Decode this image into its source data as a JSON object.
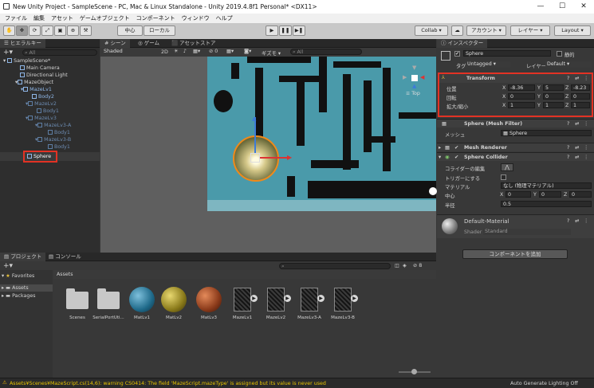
{
  "window": {
    "title": "New Unity Project - SampleScene - PC, Mac & Linux Standalone - Unity 2019.4.8f1 Personal* <DX11>"
  },
  "menu": [
    "ファイル",
    "編集",
    "アセット",
    "ゲームオブジェクト",
    "コンポーネント",
    "ウィンドウ",
    "ヘルプ"
  ],
  "toolbar": {
    "pivot": "中心",
    "space": "ローカル",
    "collab": "Collab ▾",
    "account": "アカウント ▾",
    "layers": "レイヤー ▾",
    "layout": "Layout ▾"
  },
  "hierarchy": {
    "tab": "ヒエラルキー",
    "search": "All",
    "scene": "SampleScene*",
    "items": [
      "Main Camera",
      "Directional Light",
      "MazeObject",
      "MazeLv1",
      "Body2",
      "MazeLv2",
      "Body1",
      "MazeLv3",
      "MazeLv3-A",
      "Body1",
      "MazeLv3-B",
      "Body1",
      "Sphere"
    ]
  },
  "scene": {
    "tabs": [
      "シーン",
      "ゲーム",
      "アセットストア"
    ],
    "shading": "Shaded",
    "mode2d": "2D",
    "gizmos": "ギズモ",
    "search": "All",
    "view": "Top",
    "status_value": "0"
  },
  "inspector": {
    "tab": "インスペクター",
    "name": "Sphere",
    "static": "静的",
    "tag_label": "タグ",
    "tag": "Untagged",
    "layer_label": "レイヤー",
    "layer": "Default",
    "transform": {
      "title": "Transform",
      "pos_label": "位置",
      "rot_label": "回転",
      "scale_label": "拡大/縮小",
      "pos": [
        "-8.36",
        "5",
        "-8.23"
      ],
      "rot": [
        "0",
        "0",
        "0"
      ],
      "scale": [
        "1",
        "1",
        "1"
      ]
    },
    "mesh_filter": {
      "title": "Sphere (Mesh Filter)",
      "label": "メッシュ",
      "value": "Sphere"
    },
    "mesh_renderer": {
      "title": "Mesh Renderer"
    },
    "collider": {
      "title": "Sphere Collider",
      "edit": "コライダーの編集",
      "trigger": "トリガーにする",
      "material": "マテリアル",
      "material_value": "なし (物理マテリアル)",
      "center": "中心",
      "center_vals": [
        "0",
        "0",
        "0"
      ],
      "radius": "半径",
      "radius_value": "0.5"
    },
    "material": {
      "name": "Default-Material",
      "shader_label": "Shader",
      "shader": "Standard"
    },
    "add_component": "コンポーネントを追加"
  },
  "project": {
    "tabs": [
      "プロジェクト",
      "コンソール"
    ],
    "count": "8",
    "favorites": "Favorites",
    "assets": "Assets",
    "packages": "Packages",
    "breadcrumb": "Assets",
    "items": [
      "Scenes",
      "SerialPortUti...",
      "MatLv1",
      "MatLv2",
      "MatLv3",
      "MazeLv1",
      "MazeLv2",
      "MazeLv3-A",
      "MazeLv3-B"
    ]
  },
  "status": {
    "warning": "Assets¥Scenes¥MazeScript.cs(14,6): warning CS0414: The field 'MazeScript.mazeType' is assigned but its value is never used",
    "right": "Auto Generate Lighting Off"
  },
  "colors": {
    "highlight": "#e23224",
    "maze_floor": "#4a9aaa",
    "selection": "#2c5d87"
  }
}
